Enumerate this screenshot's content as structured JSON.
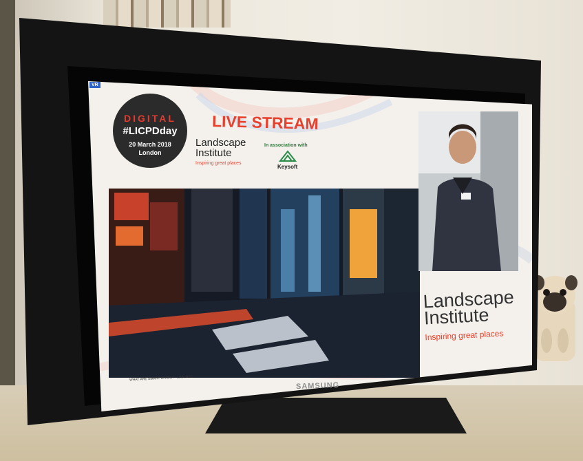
{
  "screen": {
    "badge": "VR",
    "event_disc": {
      "digital": "DIGITAL",
      "hashtag": "#LICPDday",
      "date": "20 March 2018",
      "city": "London"
    },
    "live_stream": "LIVE STREAM",
    "li_logo_small": {
      "line1": "Landscape",
      "line2": "Institute",
      "tagline": "Inspiring great places"
    },
    "association": {
      "label": "In association with",
      "partner": "Keysoft"
    },
    "slide_caption": "WHAT ARE SMART CITIES? - LINK NYC",
    "li_logo_big": {
      "line1": "Landscape",
      "line2": "Institute",
      "tagline": "Inspiring great places"
    }
  },
  "monitor": {
    "brand": "SAMSUNG"
  },
  "colors": {
    "accent_red": "#e8402c",
    "disc": "#2b2b2b",
    "bezel": "#141414"
  }
}
